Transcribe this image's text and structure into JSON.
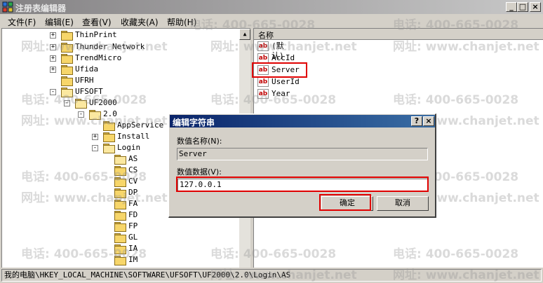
{
  "window": {
    "title": "注册表编辑器",
    "minimize": "_",
    "maximize": "□",
    "close": "×"
  },
  "menu": [
    "文件(F)",
    "编辑(E)",
    "查看(V)",
    "收藏夹(A)",
    "帮助(H)"
  ],
  "tree": {
    "nodes": [
      {
        "label": "ThinPrint",
        "expander": "+"
      },
      {
        "label": "Thunder Network",
        "expander": "+"
      },
      {
        "label": "TrendMicro",
        "expander": "+"
      },
      {
        "label": "Ufida",
        "expander": "+"
      },
      {
        "label": "UFRH",
        "expander": ""
      },
      {
        "label": "UFSOFT",
        "expander": "-"
      },
      {
        "label": "UF2000",
        "expander": "-"
      },
      {
        "label": "2.0",
        "expander": "-"
      },
      {
        "label": "AppService",
        "expander": ""
      },
      {
        "label": "Install",
        "expander": "+"
      },
      {
        "label": "Login",
        "expander": "-"
      },
      {
        "label": "AS",
        "expander": ""
      },
      {
        "label": "CS",
        "expander": ""
      },
      {
        "label": "CV",
        "expander": ""
      },
      {
        "label": "DP",
        "expander": ""
      },
      {
        "label": "FA",
        "expander": ""
      },
      {
        "label": "FD",
        "expander": ""
      },
      {
        "label": "FP",
        "expander": ""
      },
      {
        "label": "GL",
        "expander": ""
      },
      {
        "label": "IA",
        "expander": ""
      },
      {
        "label": "IM",
        "expander": ""
      }
    ],
    "scroll_up": "▲"
  },
  "list": {
    "column_header": "名称",
    "icon_text": "ab",
    "values": [
      "(默认)",
      "AccId",
      "Server",
      "UserId",
      "Year"
    ],
    "scroll_up": "▲"
  },
  "dialog": {
    "title": "编辑字符串",
    "help": "?",
    "close": "×",
    "name_label": "数值名称(N):",
    "name_value": "Server",
    "data_label": "数值数据(V):",
    "data_value": "127.0.0.1",
    "ok": "确定",
    "cancel": "取消"
  },
  "statusbar": {
    "path": "我的电脑\\HKEY_LOCAL_MACHINE\\SOFTWARE\\UFSOFT\\UF2000\\2.0\\Login\\AS"
  },
  "watermark": {
    "phone": "电话: 400-665-0028",
    "site": "网址: www.chanjet.net"
  }
}
